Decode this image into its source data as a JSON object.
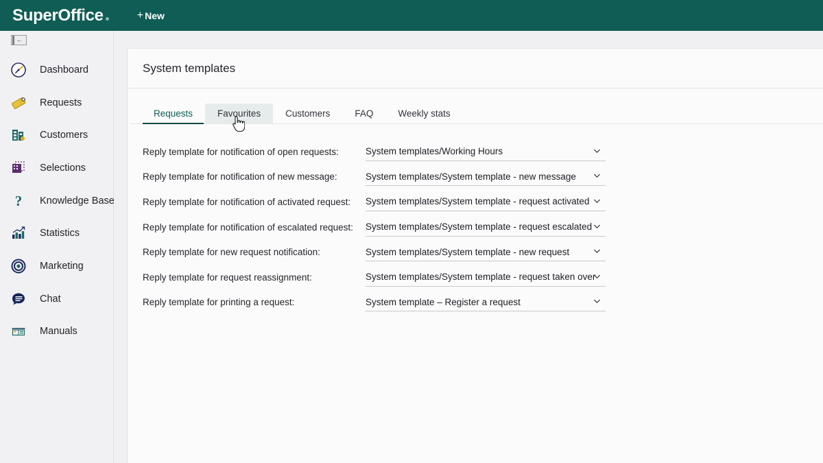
{
  "header": {
    "brand": "SuperOffice",
    "new_button": {
      "plus": "+",
      "label": "New"
    }
  },
  "sidebar": {
    "collapse_label": "←",
    "items": [
      {
        "label": "Dashboard",
        "icon": "dashboard-gauge-icon"
      },
      {
        "label": "Requests",
        "icon": "ticket-icon"
      },
      {
        "label": "Customers",
        "icon": "building-people-icon"
      },
      {
        "label": "Selections",
        "icon": "selection-grid-icon"
      },
      {
        "label": "Knowledge Base",
        "icon": "question-mark-icon"
      },
      {
        "label": "Statistics",
        "icon": "bar-chart-icon"
      },
      {
        "label": "Marketing",
        "icon": "target-icon"
      },
      {
        "label": "Chat",
        "icon": "chat-bubble-icon"
      },
      {
        "label": "Manuals",
        "icon": "manual-book-icon"
      }
    ]
  },
  "page": {
    "title": "System templates"
  },
  "tabs": [
    {
      "label": "Requests",
      "state": "active"
    },
    {
      "label": "Favourites",
      "state": "hover"
    },
    {
      "label": "Customers",
      "state": "normal"
    },
    {
      "label": "FAQ",
      "state": "normal"
    },
    {
      "label": "Weekly stats",
      "state": "normal"
    }
  ],
  "form_rows": [
    {
      "label": "Reply template for notification of open requests:",
      "value": "System templates/Working Hours"
    },
    {
      "label": "Reply template for notification of new message:",
      "value": "System templates/System template - new message"
    },
    {
      "label": "Reply template for notification of activated request:",
      "value": "System templates/System template - request activated"
    },
    {
      "label": "Reply template for notification of escalated request:",
      "value": "System templates/System template - request escalated"
    },
    {
      "label": "Reply template for new request notification:",
      "value": "System templates/System template - new request"
    },
    {
      "label": "Reply template for request reassignment:",
      "value": "System templates/System template - request taken over"
    },
    {
      "label": "Reply template for printing a request:",
      "value": "System template – Register a request"
    }
  ],
  "colors": {
    "brand_green": "#0f5d54",
    "tab_active": "#0f5d54",
    "tab_hover_bg": "#e6eceb",
    "sidebar_bg": "#f1f1f3",
    "page_bg": "#fbfbfb"
  }
}
